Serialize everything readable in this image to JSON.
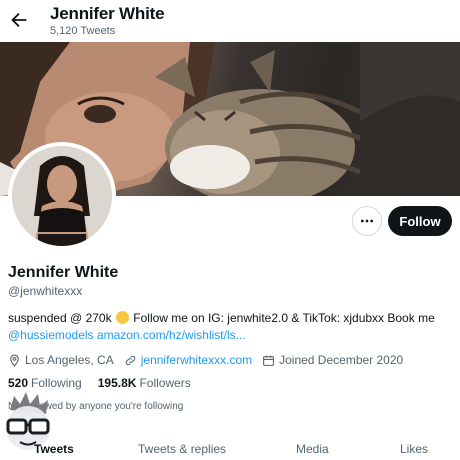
{
  "header": {
    "title": "Jennifer White",
    "tweet_count": "5,120 Tweets"
  },
  "profile": {
    "name": "Jennifer White",
    "handle": "@jenwhitexxx",
    "bio_part1": "suspended @ 270k",
    "bio_part2": " Follow me on IG: jenwhite2.0 & TikTok: xjdubxx Book me",
    "bio_link1": "@hussiemodels",
    "bio_link2": "amazon.com/hz/wishlist/ls...",
    "location": "Los Angeles, CA",
    "website": "jenniferwhitexxx.com",
    "joined": "Joined December 2020",
    "following_count": "520",
    "following_label": "Following",
    "followers_count": "195.8K",
    "followers_label": "Followers",
    "not_followed": "Not followed by anyone you're following"
  },
  "actions": {
    "follow_label": "Follow",
    "more_icon": "more-icon"
  },
  "tabs": [
    {
      "label": "Tweets"
    },
    {
      "label": "Tweets & replies"
    },
    {
      "label": "Media"
    },
    {
      "label": "Likes"
    }
  ],
  "colors": {
    "accent": "#1d9bf0",
    "text": "#0f1419",
    "secondary": "#536471"
  }
}
